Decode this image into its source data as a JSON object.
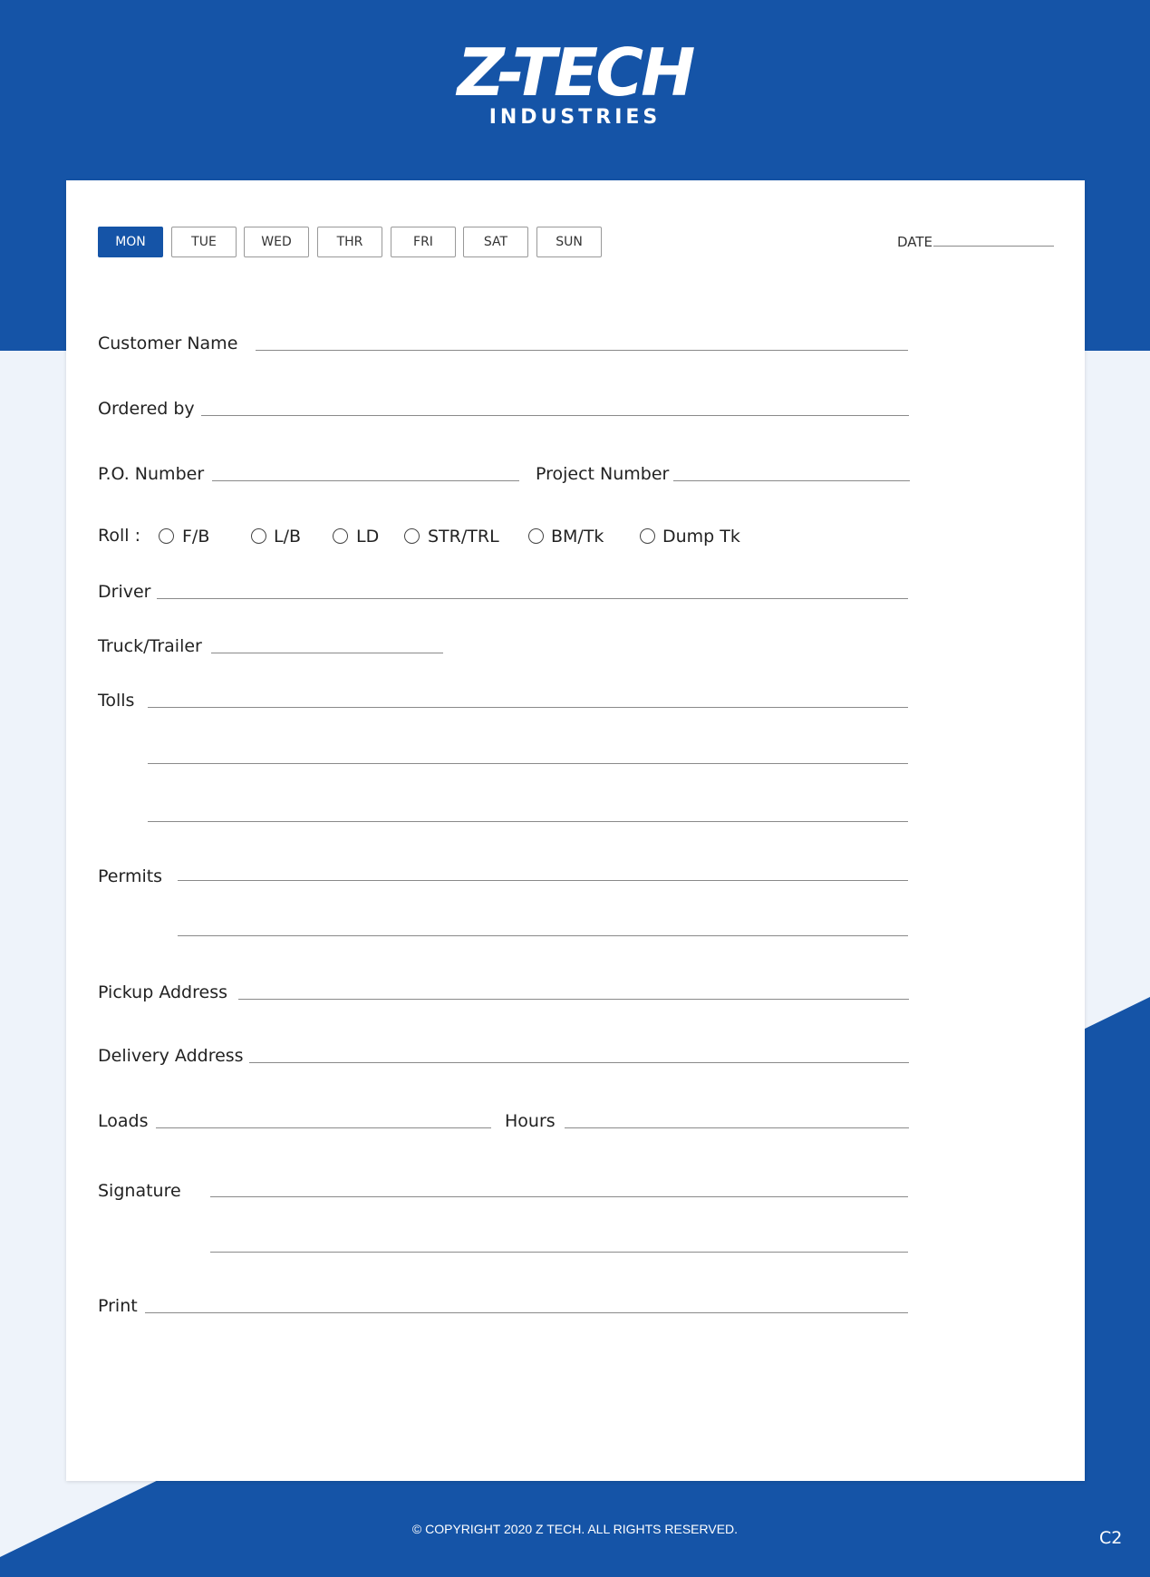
{
  "header": {
    "logo_main": "Z-TECH",
    "logo_sub": "INDUSTRIES"
  },
  "days": [
    "MON",
    "TUE",
    "WED",
    "THR",
    "FRI",
    "SAT",
    "SUN"
  ],
  "selected_day": "MON",
  "date_label": "DATE",
  "form": {
    "customer_name": "Customer Name",
    "ordered_by": "Ordered by",
    "po_number": "P.O. Number",
    "project_number": "Project Number",
    "roll_label": "Roll :",
    "roll_options": [
      "F/B",
      "L/B",
      "LD",
      "STR/TRL",
      "BM/Tk",
      "Dump Tk"
    ],
    "driver": "Driver",
    "truck_trailer": "Truck/Trailer",
    "tolls": "Tolls",
    "permits": "Permits",
    "pickup_address": "Pickup Address",
    "delivery_address": "Delivery Address",
    "loads": "Loads",
    "hours": "Hours",
    "signature": "Signature",
    "print": "Print"
  },
  "footer": {
    "copyright": "© COPYRIGHT 2020 Z TECH. ALL RIGHTS RESERVED.",
    "page_code": "C2"
  },
  "colors": {
    "brand_blue": "#1554a7",
    "background_light": "#eef3fa"
  }
}
